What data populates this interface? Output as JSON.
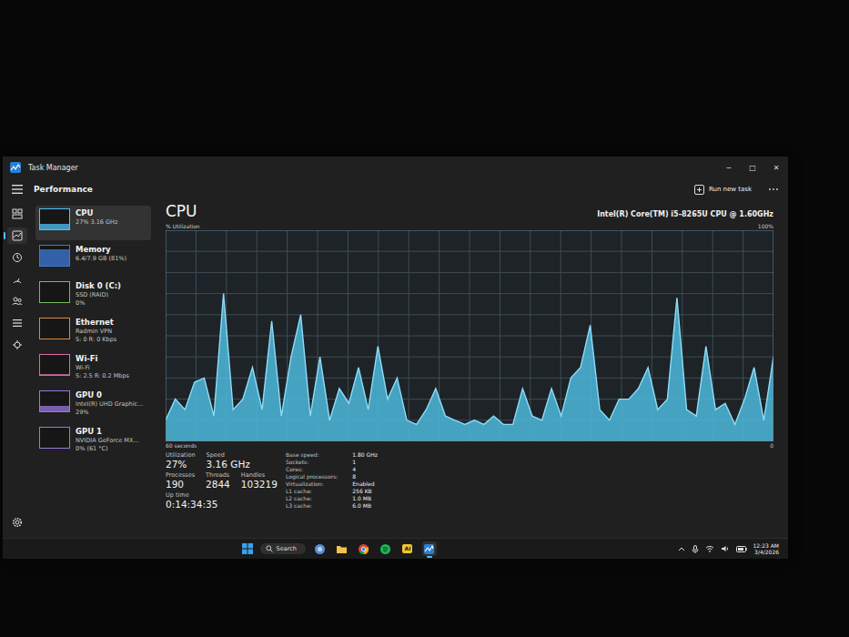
{
  "window": {
    "title": "Task Manager",
    "controls": [
      "─",
      "□",
      "✕"
    ]
  },
  "header": {
    "title": "Performance",
    "action": "Run new task"
  },
  "nav": [
    {
      "kind": "processes",
      "selected": false
    },
    {
      "kind": "performance",
      "selected": true
    },
    {
      "kind": "history",
      "selected": false
    },
    {
      "kind": "startup",
      "selected": false
    },
    {
      "kind": "users",
      "selected": false
    },
    {
      "kind": "details",
      "selected": false
    },
    {
      "kind": "services",
      "selected": false
    }
  ],
  "settings": {
    "selected": false
  },
  "sidebar": [
    {
      "name": "CPU",
      "lines": [
        "27%  3.16 GHz"
      ],
      "selected": true,
      "level": 0.27,
      "color": "#4fc3f7"
    },
    {
      "name": "Memory",
      "lines": [
        "6.4/7.9 GB (81%)"
      ],
      "selected": false,
      "level": 0.81,
      "color": "#3d7bd9"
    },
    {
      "name": "Disk 0 (C:)",
      "lines": [
        "SSD (RAID)",
        "0%"
      ],
      "selected": false,
      "level": 0,
      "color": "#6fbf5a"
    },
    {
      "name": "Ethernet",
      "lines": [
        "Radmin VPN",
        "S: 0 R: 0 Kbps"
      ],
      "selected": false,
      "level": 0,
      "color": "#d98b3a"
    },
    {
      "name": "Wi-Fi",
      "lines": [
        "Wi-Fi",
        "S: 2.5 R: 0.2 Mbps"
      ],
      "selected": false,
      "level": 0.06,
      "color": "#d96aa8"
    },
    {
      "name": "GPU 0",
      "lines": [
        "Intel(R) UHD Graphic...",
        "29%"
      ],
      "selected": false,
      "level": 0.29,
      "color": "#9a78e0"
    },
    {
      "name": "GPU 1",
      "lines": [
        "NVIDIA GeForce MX...",
        "0% (61 °C)"
      ],
      "selected": false,
      "level": 0,
      "color": "#9a78e0"
    }
  ],
  "main": {
    "title": "CPU",
    "model": "Intel(R) Core(TM) i5-8265U CPU @ 1.60GHz"
  },
  "chart": {
    "y_label": "% Utilization",
    "y_max": "100%",
    "x_label": "60 seconds",
    "y_min": "0",
    "values": [
      10,
      20,
      15,
      28,
      30,
      12,
      70,
      15,
      20,
      35,
      15,
      57,
      12,
      40,
      60,
      12,
      40,
      10,
      25,
      18,
      35,
      15,
      45,
      20,
      30,
      10,
      8,
      15,
      25,
      12,
      10,
      8,
      10,
      8,
      12,
      8,
      8,
      25,
      12,
      10,
      25,
      12,
      30,
      35,
      55,
      15,
      10,
      20,
      20,
      25,
      35,
      15,
      20,
      68,
      15,
      12,
      45,
      15,
      18,
      8,
      20,
      35,
      10,
      40
    ]
  },
  "stats": [
    [
      {
        "label": "Utilization",
        "value": "27%"
      },
      {
        "label": "Speed",
        "value": "3.16 GHz"
      }
    ],
    [
      {
        "label": "Processes",
        "value": "190"
      },
      {
        "label": "Threads",
        "value": "2844"
      },
      {
        "label": "Handles",
        "value": "103219"
      }
    ],
    [
      {
        "label": "Up time",
        "value": "0:14:34:35"
      }
    ]
  ],
  "specs": [
    {
      "label": "Base speed:",
      "value": "1.80 GHz"
    },
    {
      "label": "Sockets:",
      "value": "1"
    },
    {
      "label": "Cores:",
      "value": "4"
    },
    {
      "label": "Logical processors:",
      "value": "8"
    },
    {
      "label": "Virtualization:",
      "value": "Enabled"
    },
    {
      "label": "L1 cache:",
      "value": "256 KB"
    },
    {
      "label": "L2 cache:",
      "value": "1.0 MB"
    },
    {
      "label": "L3 cache:",
      "value": "6.0 MB"
    }
  ],
  "taskbar": {
    "search": "Search",
    "time": "12:23 AM",
    "date": "3/4/2026",
    "apps": [
      {
        "kind": "widgets",
        "label": "",
        "selected": false
      },
      {
        "kind": "explorer",
        "label": "",
        "selected": false
      },
      {
        "kind": "chrome",
        "label": "",
        "selected": false
      },
      {
        "kind": "spotify",
        "label": "",
        "selected": false
      },
      {
        "kind": "tile",
        "label": "AI",
        "selected": false
      },
      {
        "kind": "taskmgr",
        "label": "",
        "selected": true
      }
    ]
  }
}
